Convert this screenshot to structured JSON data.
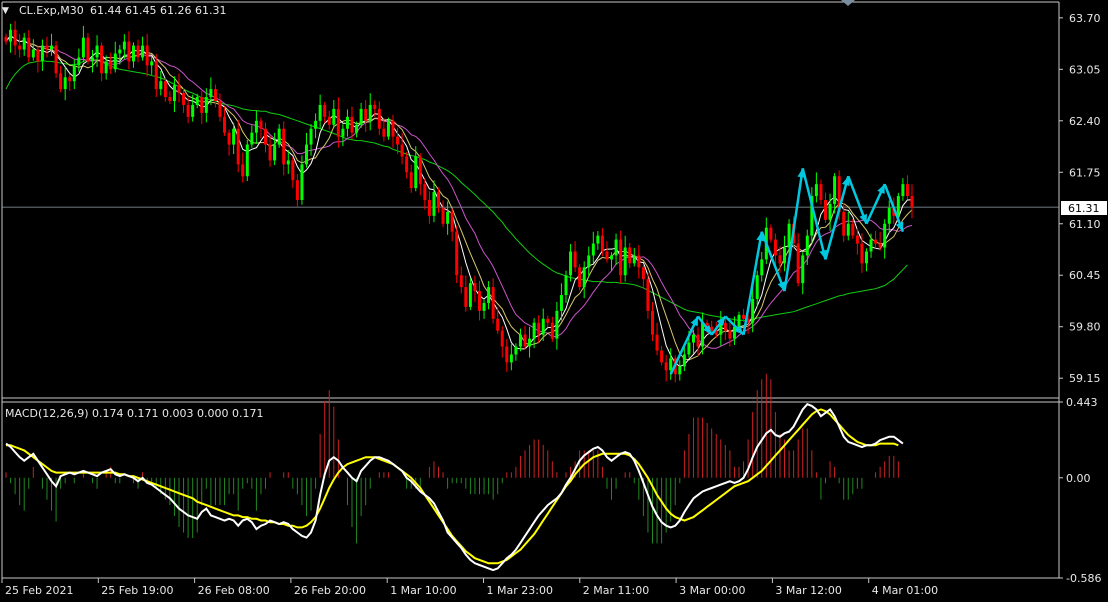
{
  "chart_data": [
    {
      "type": "candlestick",
      "header": {
        "arrow": "▼",
        "symbol_tf": "CL.Exp,M30",
        "ohlc": "61.44 61.45 61.26 61.31"
      },
      "current_price_label": "61.31",
      "y_ticks": [
        "63.70",
        "63.05",
        "62.40",
        "61.75",
        "61.10",
        "60.45",
        "59.80",
        "59.15"
      ],
      "ylim": [
        58.9,
        63.9
      ],
      "x_ticks": [
        "25 Feb 2021",
        "25 Feb 19:00",
        "26 Feb 08:00",
        "26 Feb 20:00",
        "1 Mar 10:00",
        "1 Mar 23:00",
        "2 Mar 11:00",
        "3 Mar 00:00",
        "3 Mar 12:00",
        "4 Mar 01:00"
      ],
      "colors": {
        "bull": "#00ff00",
        "bear": "#ff0000",
        "ma_green": "#11cc11",
        "ma_violet": "#cc55cc",
        "ma_khaki": "#d8c870",
        "ma_white": "#ffffff",
        "arrows": "#00c8e0"
      },
      "close": [
        63.4,
        63.55,
        63.35,
        63.3,
        63.45,
        63.2,
        63.3,
        63.15,
        63.35,
        63.3,
        63.35,
        63.0,
        62.8,
        62.95,
        62.9,
        63.1,
        63.2,
        63.45,
        63.15,
        63.2,
        63.35,
        63.0,
        63.15,
        63.05,
        63.25,
        63.3,
        63.4,
        63.15,
        63.35,
        63.2,
        63.35,
        63.1,
        63.15,
        62.8,
        62.9,
        62.7,
        62.65,
        62.85,
        62.75,
        62.6,
        62.45,
        62.6,
        62.7,
        62.5,
        62.7,
        62.8,
        62.65,
        62.45,
        62.25,
        62.1,
        62.3,
        61.85,
        61.7,
        62.1,
        62.25,
        62.4,
        62.3,
        62.1,
        61.9,
        62.1,
        62.3,
        61.85,
        61.9,
        61.65,
        61.4,
        61.85,
        62.1,
        62.3,
        62.4,
        62.6,
        62.45,
        62.35,
        62.55,
        62.2,
        62.3,
        62.45,
        62.25,
        62.35,
        62.55,
        62.4,
        62.6,
        62.55,
        62.3,
        62.2,
        62.4,
        62.2,
        62.1,
        61.95,
        61.75,
        61.55,
        61.95,
        61.6,
        61.4,
        61.2,
        61.5,
        61.3,
        61.1,
        61.25,
        61.0,
        60.45,
        60.3,
        60.05,
        60.35,
        60.25,
        60.0,
        60.1,
        60.3,
        59.9,
        59.75,
        59.55,
        59.35,
        59.45,
        59.55,
        59.7,
        59.55,
        59.65,
        59.85,
        59.7,
        59.9,
        59.85,
        59.65,
        60.0,
        60.2,
        60.45,
        60.75,
        60.55,
        60.3,
        60.55,
        60.7,
        60.85,
        60.95,
        60.75,
        60.65,
        60.7,
        60.9,
        60.45,
        60.8,
        60.6,
        60.7,
        60.55,
        60.4,
        60.0,
        59.7,
        59.5,
        59.35,
        59.25,
        59.4,
        59.2,
        59.3,
        59.45,
        59.6,
        59.7,
        59.55,
        59.85,
        59.8,
        59.75,
        59.7,
        59.85,
        59.75,
        59.65,
        59.8,
        59.95,
        59.9,
        59.85,
        60.15,
        60.45,
        60.65,
        61.05,
        60.9,
        60.7,
        60.6,
        60.8,
        61.1,
        60.85,
        60.35,
        60.7,
        60.95,
        61.45,
        61.6,
        61.4,
        61.15,
        61.35,
        61.7,
        61.25,
        60.95,
        61.1,
        60.95,
        60.85,
        60.6,
        60.75,
        60.9,
        60.85,
        60.8,
        61.1,
        61.3,
        61.2,
        61.45,
        61.6,
        61.45,
        61.31
      ],
      "sma_slow": [
        62.8,
        62.91,
        62.99,
        63.05,
        63.1,
        63.13,
        63.14,
        63.15,
        63.16,
        63.15,
        63.15,
        63.14,
        63.13,
        63.12,
        63.11,
        63.11,
        63.12,
        63.15,
        63.17,
        63.17,
        63.17,
        63.14,
        63.12,
        63.09,
        63.07,
        63.05,
        63.04,
        63.03,
        63.02,
        63.01,
        63.0,
        62.99,
        62.97,
        62.96,
        62.94,
        62.92,
        62.89,
        62.86,
        62.83,
        62.8,
        62.77,
        62.75,
        62.72,
        62.69,
        62.68,
        62.66,
        62.65,
        62.63,
        62.61,
        62.6,
        62.59,
        62.57,
        62.55,
        62.54,
        62.53,
        62.53,
        62.52,
        62.52,
        62.5,
        62.49,
        62.48,
        62.46,
        62.44,
        62.42,
        62.4,
        62.38,
        62.36,
        62.34,
        62.32,
        62.3,
        62.28,
        62.26,
        62.24,
        62.22,
        62.19,
        62.17,
        62.16,
        62.15,
        62.15,
        62.14,
        62.13,
        62.12,
        62.1,
        62.08,
        62.07,
        62.04,
        62.02,
        62.0,
        61.98,
        61.96,
        61.95,
        61.93,
        61.91,
        61.88,
        61.86,
        61.83,
        61.8,
        61.77,
        61.73,
        61.68,
        61.62,
        61.57,
        61.52,
        61.47,
        61.41,
        61.36,
        61.3,
        61.25,
        61.18,
        61.12,
        61.04,
        60.98,
        60.91,
        60.85,
        60.79,
        60.73,
        60.68,
        60.63,
        60.59,
        60.55,
        60.51,
        60.48,
        60.46,
        60.44,
        60.42,
        60.41,
        60.4,
        60.39,
        60.38,
        60.37,
        60.37,
        60.37,
        60.36,
        60.36,
        60.36,
        60.35,
        60.35,
        60.34,
        60.33,
        60.31,
        60.29,
        60.26,
        60.23,
        60.2,
        60.17,
        60.14,
        60.11,
        60.08,
        60.05,
        60.02,
        60.0,
        59.99,
        59.98,
        59.97,
        59.95,
        59.94,
        59.93,
        59.92,
        59.91,
        59.9,
        59.89,
        59.88,
        59.88,
        59.88,
        59.89,
        59.91,
        59.92,
        59.93,
        59.94,
        59.95,
        59.96,
        59.97,
        59.98,
        59.99,
        60.01,
        60.03,
        60.05,
        60.07,
        60.09,
        60.11,
        60.13,
        60.15,
        60.17,
        60.19,
        60.2,
        60.22,
        60.23,
        60.24,
        60.25,
        60.26,
        60.27,
        60.28,
        60.3,
        60.32,
        60.36,
        60.4,
        60.46,
        60.52,
        60.58
      ],
      "zigzag": [
        [
          146,
          59.2
        ],
        [
          152,
          59.93
        ],
        [
          155,
          59.7
        ],
        [
          158,
          59.93
        ],
        [
          162,
          59.7
        ],
        [
          166,
          61.0
        ],
        [
          171,
          60.25
        ],
        [
          175,
          61.8
        ],
        [
          180,
          60.65
        ],
        [
          185,
          61.7
        ],
        [
          189,
          61.1
        ]
      ],
      "projection": [
        [
          189,
          61.1
        ],
        [
          193,
          61.6
        ],
        [
          197,
          61.0
        ]
      ],
      "macd": {
        "label": "MACD(12,26,9) 0.174 0.171 0.003 0.000 0.171",
        "ylim": [
          -0.586,
          0.443
        ],
        "y_ticks": [
          "0.443",
          "0.00",
          "-0.586"
        ],
        "macd": [
          0.2,
          0.18,
          0.15,
          0.12,
          0.1,
          0.12,
          0.14,
          0.1,
          0.06,
          0.02,
          -0.02,
          -0.05,
          0.01,
          0.02,
          0.03,
          0.02,
          0.03,
          0.04,
          0.03,
          0.02,
          0.01,
          0.03,
          0.04,
          0.05,
          0.02,
          0.01,
          0.02,
          0.01,
          0.0,
          -0.02,
          0.0,
          -0.03,
          -0.04,
          -0.06,
          -0.08,
          -0.1,
          -0.12,
          -0.15,
          -0.18,
          -0.2,
          -0.22,
          -0.23,
          -0.24,
          -0.2,
          -0.18,
          -0.22,
          -0.23,
          -0.24,
          -0.25,
          -0.24,
          -0.25,
          -0.28,
          -0.25,
          -0.24,
          -0.26,
          -0.3,
          -0.28,
          -0.27,
          -0.25,
          -0.26,
          -0.27,
          -0.26,
          -0.27,
          -0.3,
          -0.32,
          -0.34,
          -0.35,
          -0.32,
          -0.25,
          -0.1,
          0.02,
          0.1,
          0.12,
          0.1,
          0.06,
          0.03,
          0.0,
          -0.02,
          0.04,
          0.07,
          0.1,
          0.12,
          0.12,
          0.11,
          0.1,
          0.08,
          0.06,
          0.04,
          0.0,
          -0.02,
          -0.05,
          -0.08,
          -0.1,
          -0.12,
          -0.15,
          -0.2,
          -0.25,
          -0.32,
          -0.35,
          -0.38,
          -0.41,
          -0.45,
          -0.48,
          -0.5,
          -0.51,
          -0.52,
          -0.53,
          -0.54,
          -0.53,
          -0.5,
          -0.47,
          -0.45,
          -0.42,
          -0.38,
          -0.34,
          -0.3,
          -0.26,
          -0.22,
          -0.19,
          -0.16,
          -0.14,
          -0.12,
          -0.09,
          -0.04,
          0.0,
          0.05,
          0.1,
          0.13,
          0.15,
          0.17,
          0.18,
          0.16,
          0.12,
          0.1,
          0.12,
          0.14,
          0.15,
          0.14,
          0.1,
          0.04,
          -0.03,
          -0.1,
          -0.17,
          -0.22,
          -0.26,
          -0.28,
          -0.29,
          -0.28,
          -0.25,
          -0.2,
          -0.16,
          -0.12,
          -0.1,
          -0.08,
          -0.07,
          -0.06,
          -0.05,
          -0.04,
          -0.03,
          -0.02,
          -0.03,
          -0.02,
          0.0,
          0.05,
          0.12,
          0.18,
          0.22,
          0.26,
          0.28,
          0.25,
          0.24,
          0.26,
          0.27,
          0.3,
          0.35,
          0.4,
          0.43,
          0.42,
          0.4,
          0.36,
          0.38,
          0.4,
          0.36,
          0.3,
          0.24,
          0.21,
          0.2,
          0.19,
          0.18,
          0.19,
          0.19,
          0.2,
          0.22,
          0.23,
          0.24,
          0.24,
          0.22,
          0.2
        ],
        "signal": [
          0.19,
          0.19,
          0.18,
          0.17,
          0.16,
          0.14,
          0.12,
          0.1,
          0.08,
          0.06,
          0.04,
          0.03,
          0.03,
          0.03,
          0.03,
          0.03,
          0.03,
          0.03,
          0.03,
          0.03,
          0.03,
          0.03,
          0.03,
          0.03,
          0.03,
          0.02,
          0.02,
          0.01,
          0.01,
          0.0,
          -0.01,
          -0.02,
          -0.03,
          -0.04,
          -0.05,
          -0.06,
          -0.07,
          -0.08,
          -0.09,
          -0.1,
          -0.11,
          -0.12,
          -0.14,
          -0.15,
          -0.16,
          -0.17,
          -0.18,
          -0.19,
          -0.2,
          -0.21,
          -0.22,
          -0.22,
          -0.23,
          -0.23,
          -0.24,
          -0.24,
          -0.25,
          -0.25,
          -0.26,
          -0.26,
          -0.27,
          -0.27,
          -0.28,
          -0.28,
          -0.29,
          -0.29,
          -0.28,
          -0.26,
          -0.23,
          -0.18,
          -0.12,
          -0.06,
          -0.01,
          0.03,
          0.06,
          0.08,
          0.09,
          0.1,
          0.11,
          0.12,
          0.12,
          0.12,
          0.11,
          0.1,
          0.09,
          0.08,
          0.06,
          0.04,
          0.02,
          0.0,
          -0.03,
          -0.06,
          -0.1,
          -0.14,
          -0.18,
          -0.22,
          -0.26,
          -0.3,
          -0.34,
          -0.37,
          -0.4,
          -0.43,
          -0.45,
          -0.47,
          -0.48,
          -0.49,
          -0.5,
          -0.5,
          -0.5,
          -0.49,
          -0.48,
          -0.46,
          -0.44,
          -0.42,
          -0.39,
          -0.36,
          -0.33,
          -0.29,
          -0.25,
          -0.21,
          -0.17,
          -0.13,
          -0.09,
          -0.05,
          -0.02,
          0.02,
          0.05,
          0.08,
          0.1,
          0.12,
          0.13,
          0.14,
          0.14,
          0.14,
          0.14,
          0.14,
          0.14,
          0.13,
          0.11,
          0.08,
          0.04,
          0.0,
          -0.05,
          -0.1,
          -0.14,
          -0.18,
          -0.21,
          -0.23,
          -0.24,
          -0.25,
          -0.24,
          -0.23,
          -0.21,
          -0.19,
          -0.17,
          -0.15,
          -0.13,
          -0.11,
          -0.09,
          -0.07,
          -0.05,
          -0.04,
          -0.03,
          -0.02,
          0.0,
          0.02,
          0.04,
          0.07,
          0.1,
          0.13,
          0.16,
          0.19,
          0.22,
          0.25,
          0.28,
          0.31,
          0.34,
          0.37,
          0.39,
          0.4,
          0.39,
          0.37,
          0.34,
          0.31,
          0.28,
          0.25,
          0.23,
          0.21,
          0.2,
          0.19,
          0.19,
          0.19,
          0.2,
          0.2,
          0.2,
          0.2,
          0.19
        ]
      }
    }
  ]
}
